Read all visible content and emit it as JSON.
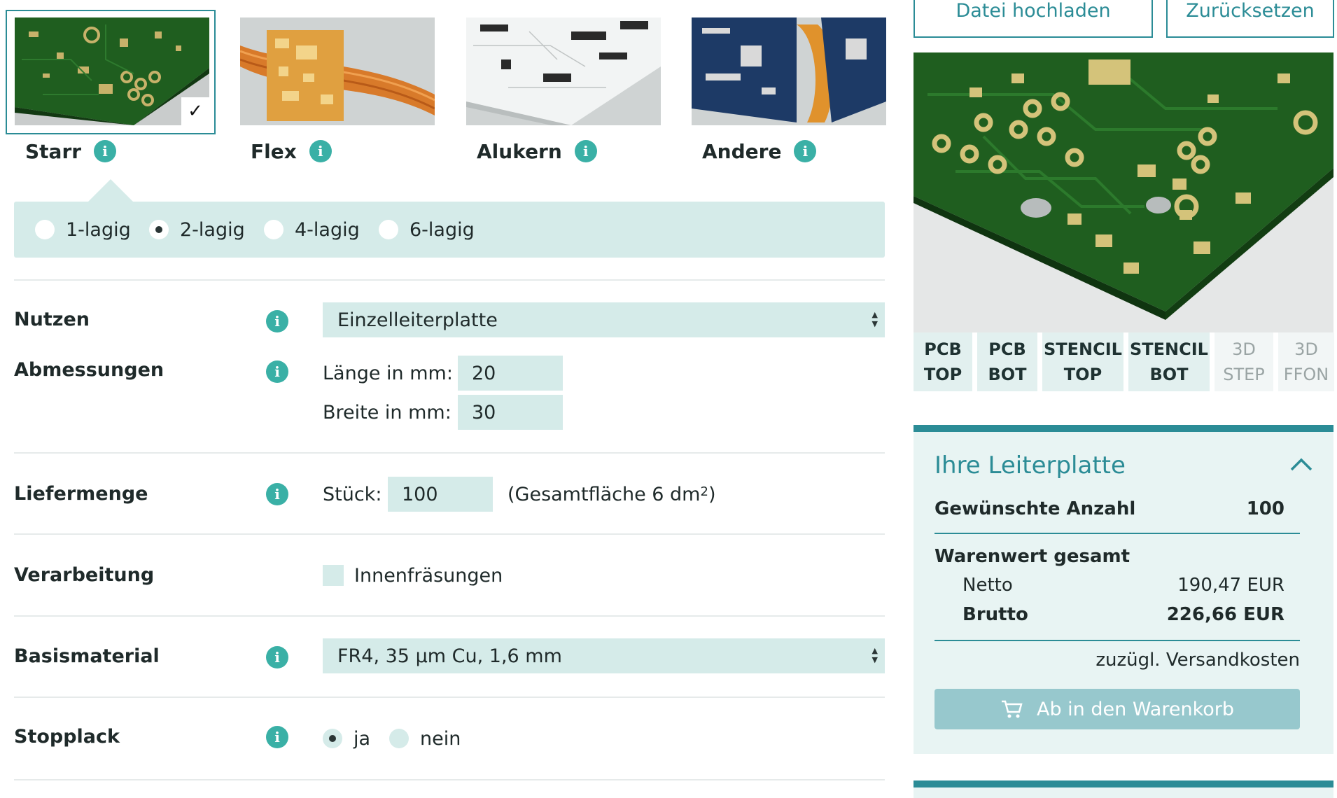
{
  "board_types": [
    {
      "label": "Starr",
      "selected": true
    },
    {
      "label": "Flex",
      "selected": false
    },
    {
      "label": "Alukern",
      "selected": false
    },
    {
      "label": "Andere",
      "selected": false
    }
  ],
  "check_mark": "✓",
  "info_glyph": "i",
  "layers": {
    "options": [
      "1-lagig",
      "2-lagig",
      "4-lagig",
      "6-lagig"
    ],
    "selected": "2-lagig"
  },
  "form": {
    "nutzen": {
      "label": "Nutzen",
      "value": "Einzelleiterplatte"
    },
    "abmessungen": {
      "label": "Abmessungen",
      "length_label": "Länge in mm:",
      "length_value": "20",
      "width_label": "Breite in mm:",
      "width_value": "30"
    },
    "liefermenge": {
      "label": "Liefermenge",
      "qty_label": "Stück:",
      "qty_value": "100",
      "area_prefix": "(Gesamtfläche 6 dm",
      "area_sup": "2",
      "area_suffix": ")"
    },
    "verarbeitung": {
      "label": "Verarbeitung",
      "option": "Innenfräsungen",
      "checked": false
    },
    "basismaterial": {
      "label": "Basismaterial",
      "value": "FR4, 35 µm Cu, 1,6 mm"
    },
    "stopplack": {
      "label": "Stopplack",
      "options": [
        "ja",
        "nein"
      ],
      "selected": "ja"
    }
  },
  "actions": {
    "upload": "Datei hochladen",
    "reset": "Zurücksetzen"
  },
  "preview_tabs": [
    {
      "line1": "PCB",
      "line2": "TOP",
      "enabled": true
    },
    {
      "line1": "PCB",
      "line2": "BOT",
      "enabled": true
    },
    {
      "line1": "STENCIL",
      "line2": "TOP",
      "enabled": true
    },
    {
      "line1": "STENCIL",
      "line2": "BOT",
      "enabled": true
    },
    {
      "line1": "3D",
      "line2": "STEP",
      "enabled": false
    },
    {
      "line1": "3D",
      "line2": "FFON",
      "enabled": false
    }
  ],
  "summary": {
    "title": "Ihre Leiterplatte",
    "qty_label": "Gewünschte Anzahl",
    "qty_value": "100",
    "total_label": "Warenwert gesamt",
    "net_label": "Netto",
    "net_value": "190,47 EUR",
    "gross_label": "Brutto",
    "gross_value": "226,66 EUR",
    "shipping_note": "zuzügl. Versandkosten",
    "cart_button": "Ab in den Warenkorb"
  },
  "colors": {
    "accent": "#2b8c96",
    "panel": "#d5ebe9",
    "info": "#3ab0a6",
    "pcb_green": "#1f5e1f"
  }
}
